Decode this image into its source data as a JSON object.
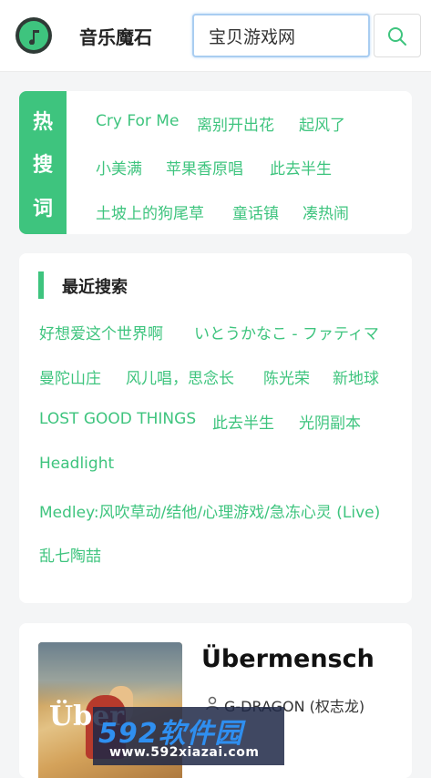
{
  "header": {
    "app_title": "音乐魔石",
    "search_value": "宝贝游戏网",
    "logo_icon": "music-note-icon",
    "search_icon": "search-icon"
  },
  "hot": {
    "badge_chars": [
      "热",
      "搜",
      "词"
    ],
    "items": [
      "Cry For Me",
      "离别开出花",
      "起风了",
      "小美满",
      "苹果香原唱",
      "此去半生",
      "土坡上的狗尾草",
      "童话镇",
      "凑热闹"
    ]
  },
  "recent": {
    "title": "最近搜索",
    "items": [
      "好想爱这个世界啊",
      "いとうかなこ - ファティマ",
      "曼陀山庄",
      "风儿唱，思念长",
      "陈光荣",
      "新地球",
      "LOST GOOD THINGS",
      "此去半生",
      "光阴副本",
      "Headlight",
      "Medley:风吹草动/结他/心理游戏/急冻心灵 (Live)",
      "乱七陶喆"
    ]
  },
  "song": {
    "title": "Übermensch",
    "artist": "G-DRAGON (权志龙)",
    "cover_text": "Über",
    "artist_icon": "person-icon"
  },
  "watermark": {
    "logo": "592软件园",
    "url": "www.592xiazai.com"
  },
  "colors": {
    "accent": "#3ec47e",
    "background": "#f4f5f6",
    "search_border": "#a9cdf1"
  }
}
